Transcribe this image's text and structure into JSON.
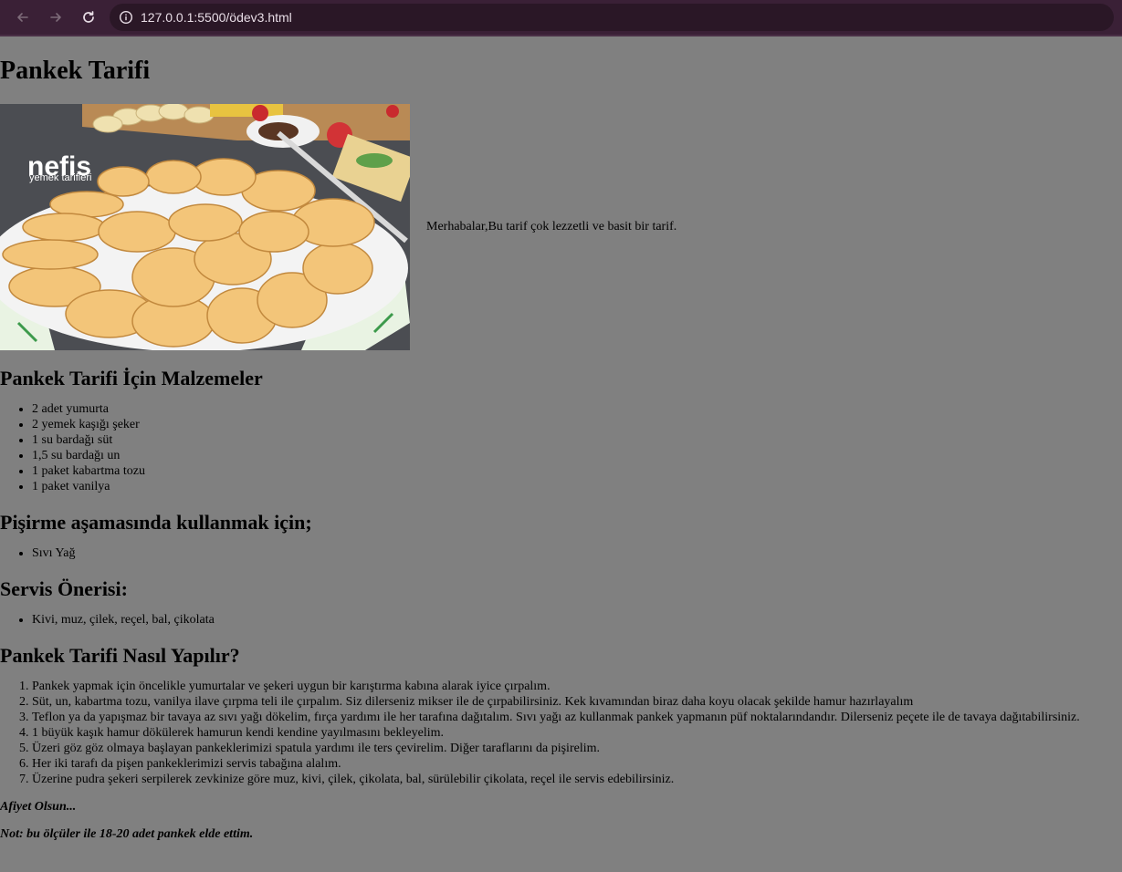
{
  "browser": {
    "url": "127.0.0.1:5500/ödev3.html"
  },
  "page": {
    "title": "Pankek Tarifi",
    "intro": "Merhabalar,Bu tarif çok lezzetli ve basit bir tarif.",
    "hero_logo_main": "nefis",
    "hero_logo_sub": "yemek tarifleri",
    "ingredients_heading": "Pankek Tarifi İçin Malzemeler",
    "ingredients": [
      "2 adet yumurta",
      "2 yemek kaşığı şeker",
      "1 su bardağı süt",
      "1,5 su bardağı un",
      "1 paket kabartma tozu",
      "1 paket vanilya"
    ],
    "cooking_heading": "Pişirme aşamasında kullanmak için;",
    "cooking_items": [
      "Sıvı Yağ"
    ],
    "serving_heading": "Servis Önerisi:",
    "serving_items": [
      "Kivi, muz, çilek, reçel, bal, çikolata"
    ],
    "steps_heading": "Pankek Tarifi Nasıl Yapılır?",
    "steps": [
      "Pankek yapmak için öncelikle yumurtalar ve şekeri uygun bir karıştırma kabına alarak iyice çırpalım.",
      "Süt, un, kabartma tozu, vanilya ilave çırpma teli ile çırpalım. Siz dilerseniz mikser ile de çırpabilirsiniz. Kek kıvamından biraz daha koyu olacak şekilde hamur hazırlayalım",
      "Teflon ya da yapışmaz bir tavaya az sıvı yağı dökelim, fırça yardımı ile her tarafına dağıtalım. Sıvı yağı az kullanmak pankek yapmanın püf noktalarındandır. Dilerseniz peçete ile de tavaya dağıtabilirsiniz.",
      "1 büyük kaşık hamur dökülerek hamurun kendi kendine yayılmasını bekleyelim.",
      "Üzeri göz göz olmaya başlayan pankeklerimizi spatula yardımı ile ters çevirelim. Diğer taraflarını da pişirelim.",
      "Her iki tarafı da pişen pankeklerimizi servis tabağına alalım.",
      "Üzerine pudra şekeri serpilerek zevkinize göre muz, kivi, çilek, çikolata, bal, sürülebilir çikolata, reçel ile servis edebilirsiniz."
    ],
    "closing": "Afiyet Olsun...",
    "note": "Not: bu ölçüler ile 18-20 adet pankek elde ettim."
  }
}
